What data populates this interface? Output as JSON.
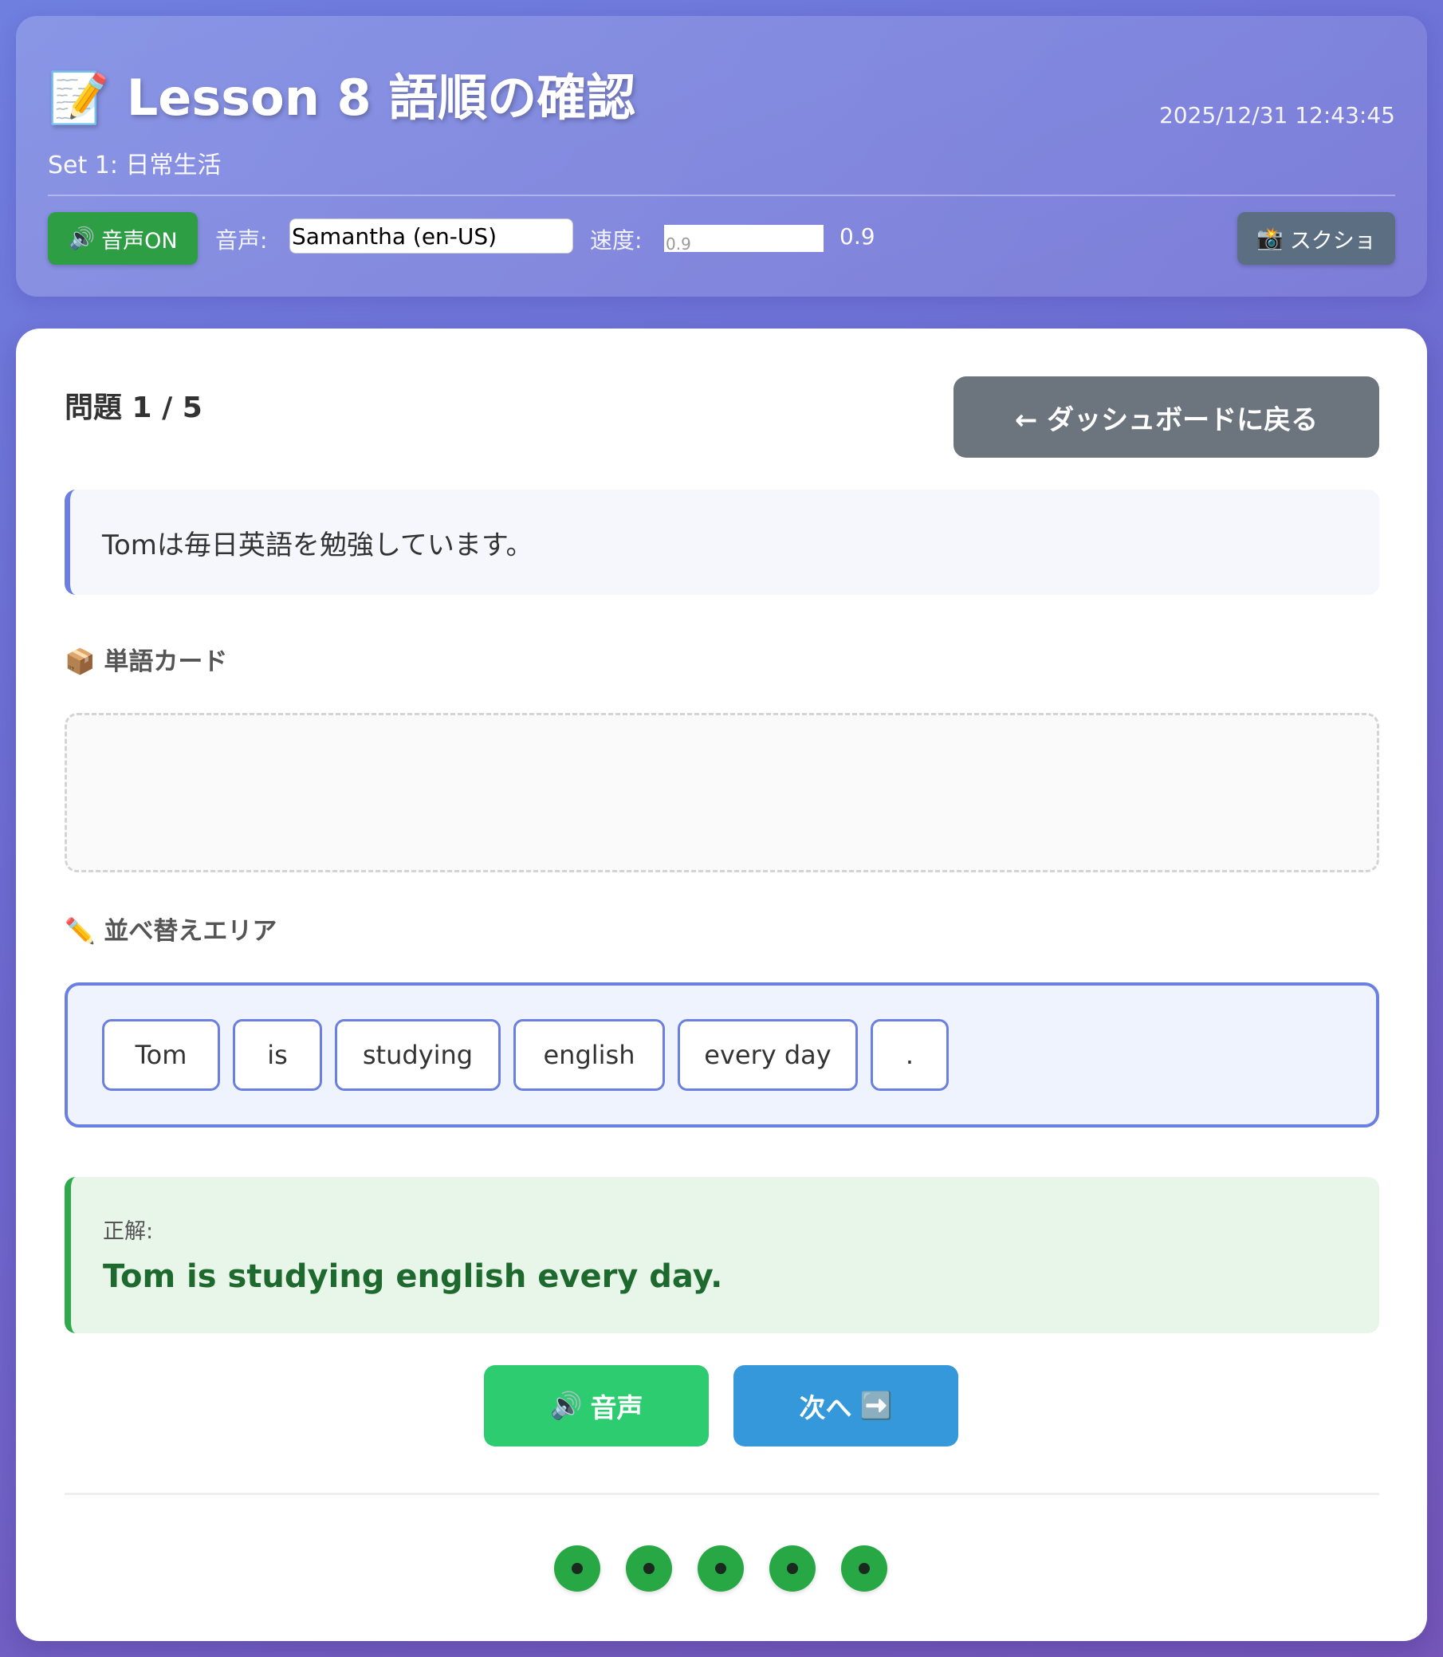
{
  "header": {
    "title_icon": "📝",
    "title": "Lesson 8 語順の確認",
    "subtitle": "Set 1: 日常生活",
    "datetime": "2025/12/31 12:43:45"
  },
  "controls": {
    "sound_toggle_icon": "🔊",
    "sound_toggle_label": "音声ON",
    "voice_label": "音声:",
    "voice_value": "Samantha (en-US)",
    "speed_label": "速度:",
    "speed_input_value": "0.9",
    "speed_display": "0.9",
    "screenshot_icon": "📸",
    "screenshot_label": "スクショ"
  },
  "quiz": {
    "counter": "問題 1 / 5",
    "back_button": "← ダッシュボードに戻る",
    "prompt": "Tomは毎日英語を勉強しています。",
    "word_bank_icon": "📦",
    "word_bank_label": "単語カード",
    "word_bank_items": [],
    "arrange_icon": "✏️",
    "arrange_label": "並べ替えエリア",
    "arranged_words": [
      "Tom",
      "is",
      "studying",
      "english",
      "every day",
      "."
    ],
    "answer_label": "正解:",
    "answer_text": "Tom is studying english every day."
  },
  "actions": {
    "audio_icon": "🔊",
    "audio_label": "音声",
    "next_label": "次へ",
    "next_icon": "➡️"
  },
  "progress": {
    "total": 5,
    "completed": 5
  },
  "colors": {
    "accent": "#6b7fe0",
    "success": "#28a745",
    "answer_text": "#1e6a2e",
    "audio_button": "#2ecc71",
    "next_button": "#3498db",
    "back_button": "#6c757d"
  }
}
